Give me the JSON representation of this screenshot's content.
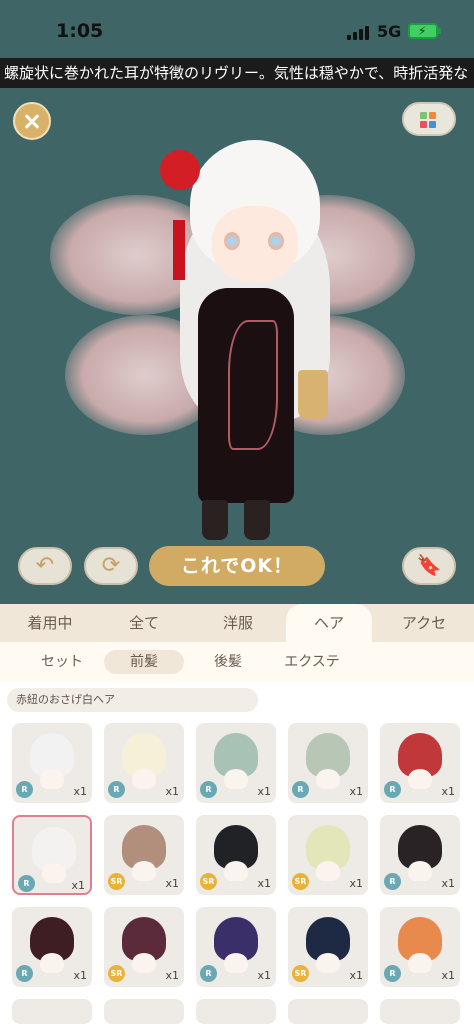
{
  "status": {
    "time": "1:05",
    "network": "5G"
  },
  "marquee": "螺旋状に巻かれた耳が特徴のリヴリー。気性は穏やかで、時折活発な",
  "stage": {
    "confirm_label": "これでOK！",
    "icons": {
      "close": "close-icon",
      "grid": "color-grid-icon",
      "undo": "undo-icon",
      "rotate": "rotate-icon",
      "bookmark": "bookmark-icon"
    }
  },
  "main_tabs": [
    {
      "label": "着用中"
    },
    {
      "label": "全て"
    },
    {
      "label": "洋服"
    },
    {
      "label": "ヘア",
      "active": true
    },
    {
      "label": "アクセ"
    }
  ],
  "sub_tabs": [
    {
      "label": "セット"
    },
    {
      "label": "前髪",
      "active": true
    },
    {
      "label": "後髪"
    },
    {
      "label": "エクステ"
    }
  ],
  "selected_item_name": "赤紐のおさげ白ヘア",
  "items": [
    {
      "rarity": "R",
      "qty": "x1",
      "color": "#f2f2f2"
    },
    {
      "rarity": "R",
      "qty": "x1",
      "color": "#f7f0d8"
    },
    {
      "rarity": "R",
      "qty": "x1",
      "color": "#a8c2b5"
    },
    {
      "rarity": "R",
      "qty": "x1",
      "color": "#b7c6b5"
    },
    {
      "rarity": "R",
      "qty": "x1",
      "color": "#c0383a"
    },
    {
      "rarity": "R",
      "qty": "x1",
      "color": "#f4f2f0",
      "selected": true
    },
    {
      "rarity": "SR",
      "qty": "x1",
      "color": "#b18f7c"
    },
    {
      "rarity": "SR",
      "qty": "x1",
      "color": "#202226"
    },
    {
      "rarity": "SR",
      "qty": "x1",
      "color": "#e3e6b9"
    },
    {
      "rarity": "R",
      "qty": "x1",
      "color": "#2a2325"
    },
    {
      "rarity": "R",
      "qty": "x1",
      "color": "#3e1e22"
    },
    {
      "rarity": "SR",
      "qty": "x1",
      "color": "#5b2a3b"
    },
    {
      "rarity": "R",
      "qty": "x1",
      "color": "#3b2f6a"
    },
    {
      "rarity": "SR",
      "qty": "x1",
      "color": "#1e2a44"
    },
    {
      "rarity": "R",
      "qty": "x1",
      "color": "#e88a4e"
    }
  ],
  "colors": {
    "rarity_r": "#6aa9b4",
    "rarity_sr": "#eab23b"
  }
}
